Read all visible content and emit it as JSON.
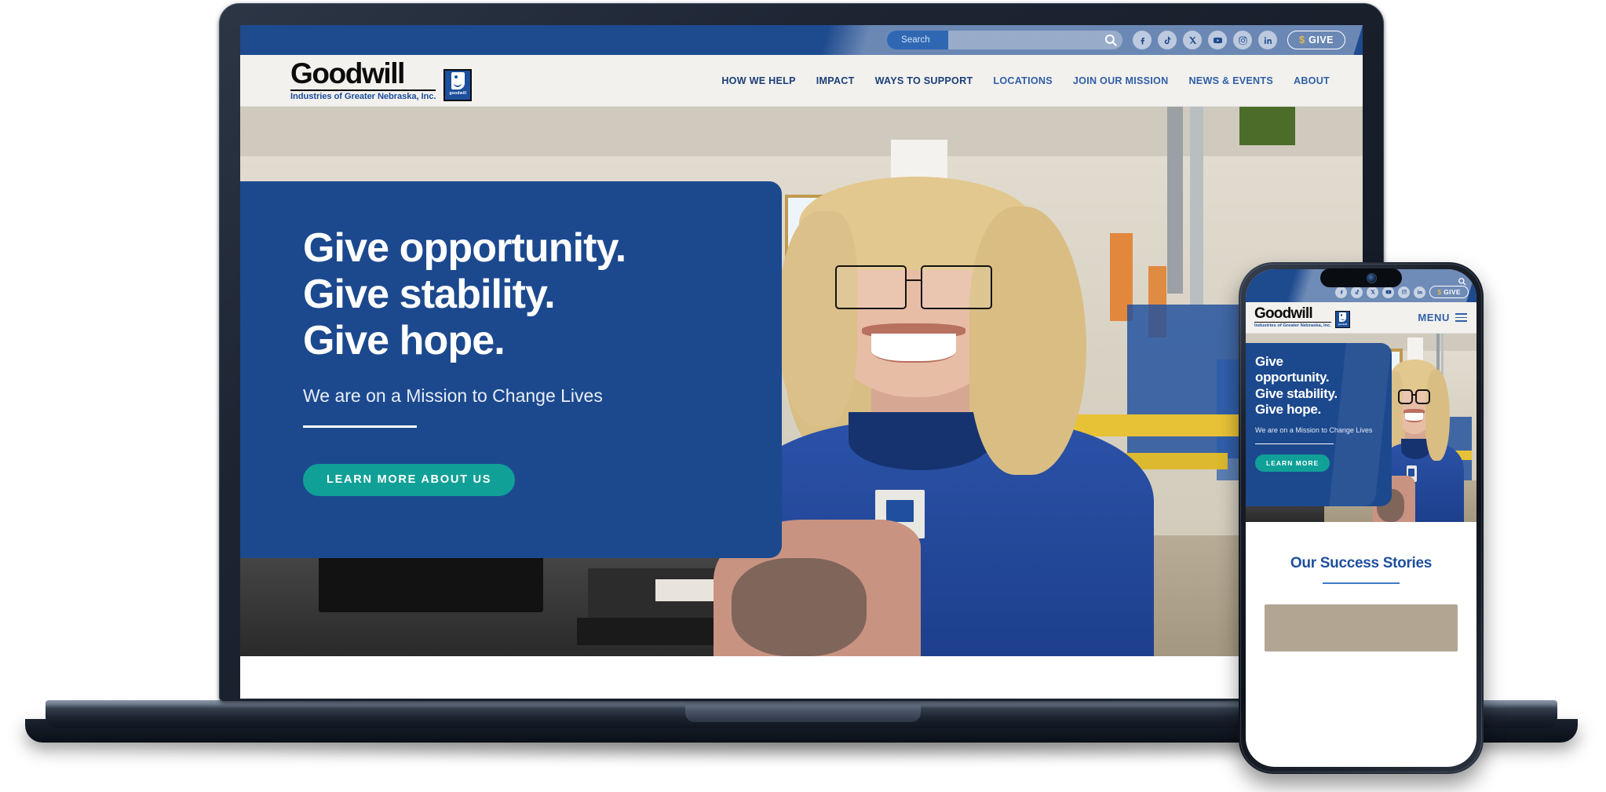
{
  "site": {
    "topbar": {
      "search_placeholder": "Search",
      "search_value": "",
      "search_icon": "search-icon",
      "socials": [
        {
          "name": "facebook-icon",
          "label": "Facebook"
        },
        {
          "name": "tiktok-icon",
          "label": "TikTok"
        },
        {
          "name": "x-twitter-icon",
          "label": "X"
        },
        {
          "name": "youtube-icon",
          "label": "YouTube"
        },
        {
          "name": "instagram-icon",
          "label": "Instagram"
        },
        {
          "name": "linkedin-icon",
          "label": "LinkedIn"
        }
      ],
      "give_symbol": "$",
      "give_label": "GIVE"
    },
    "header": {
      "logo_word": "Goodwill",
      "logo_tagline": "Industries of Greater Nebraska, Inc.",
      "logo_mark_word": "goodwill",
      "nav": [
        {
          "label": "HOW WE HELP"
        },
        {
          "label": "IMPACT"
        },
        {
          "label": "WAYS TO SUPPORT"
        },
        {
          "label": "LOCATIONS"
        },
        {
          "label": "JOIN OUR MISSION"
        },
        {
          "label": "NEWS & EVENTS"
        },
        {
          "label": "ABOUT"
        }
      ]
    },
    "hero": {
      "line1": "Give opportunity.",
      "line2": "Give stability.",
      "line3": "Give hope.",
      "subtitle": "We are on a Mission to Change Lives",
      "cta_label": "LEARN MORE ABOUT US"
    }
  },
  "phone": {
    "topbar": {
      "search_icon": "search-icon",
      "socials": [
        {
          "name": "facebook-icon",
          "label": "Facebook"
        },
        {
          "name": "tiktok-icon",
          "label": "TikTok"
        },
        {
          "name": "x-twitter-icon",
          "label": "X"
        },
        {
          "name": "youtube-icon",
          "label": "YouTube"
        },
        {
          "name": "instagram-icon",
          "label": "Instagram"
        },
        {
          "name": "linkedin-icon",
          "label": "LinkedIn"
        }
      ],
      "give_symbol": "$",
      "give_label": "GIVE"
    },
    "header": {
      "logo_word": "Goodwill",
      "logo_tagline": "Industries of Greater Nebraska, Inc.",
      "logo_mark_word": "goodwill",
      "menu_label": "MENU"
    },
    "hero": {
      "line1": "Give",
      "line2": "opportunity.",
      "line3": "Give stability.",
      "line4": "Give hope.",
      "subtitle": "We are on a Mission to Change Lives",
      "cta_label": "LEARN MORE"
    },
    "stories": {
      "title": "Our Success Stories"
    }
  },
  "colors": {
    "brand_blue": "#1e4a8e",
    "hero_blue": "#1c498e",
    "nav_blue": "#2f5fa8",
    "teal_cta": "#10a097",
    "give_gold": "#e8b84b",
    "header_bg": "#f2f1ee",
    "device_frame": "#1d2533"
  }
}
